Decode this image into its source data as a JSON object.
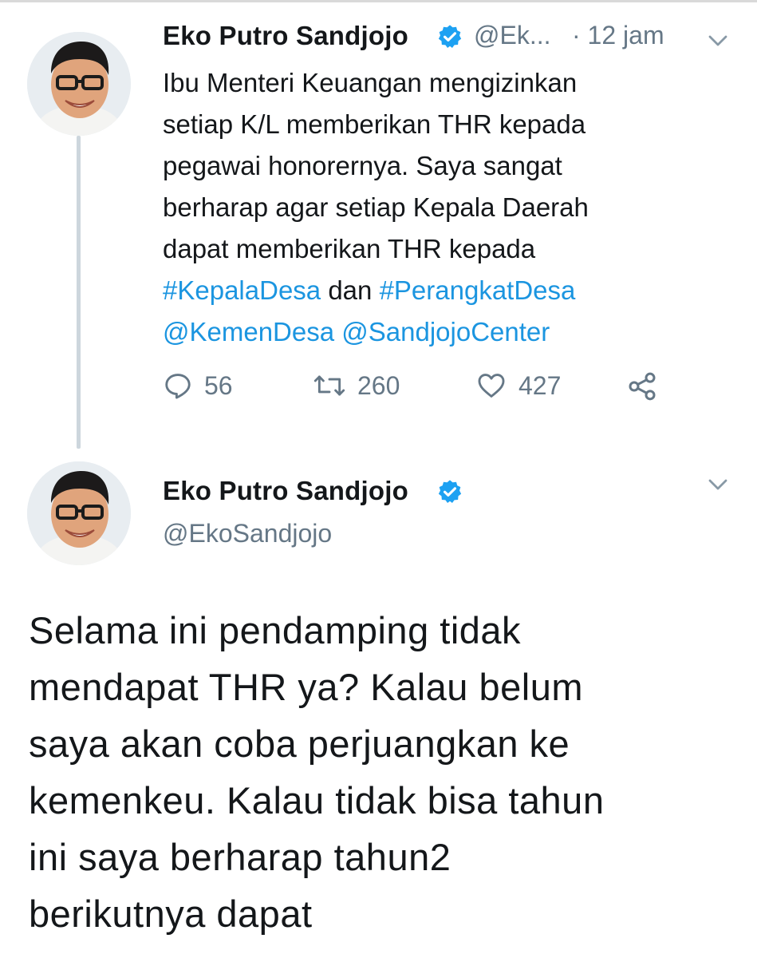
{
  "tweet1": {
    "author_name": "Eko Putro Sandjojo",
    "handle": "@Ek...",
    "time": "· 12 jam",
    "body_lines": [
      "Ibu Menteri Keuangan mengizinkan",
      "setiap K/L memberikan THR kepada",
      "pegawai honorernya. Saya sangat",
      "berharap agar setiap Kepala Daerah",
      "dapat memberikan THR kepada"
    ],
    "hashtag1": "#KepalaDesa",
    "conjunction": " dan ",
    "hashtag2": "#PerangkatDesa",
    "mention1": "@KemenDesa",
    "mention2": "@SandjojoCenter",
    "reply_count": "56",
    "retweet_count": "260",
    "like_count": "427"
  },
  "tweet2": {
    "author_name": "Eko Putro Sandjojo",
    "handle": "@EkoSandjojo",
    "body_lines": [
      "Selama ini pendamping tidak",
      "mendapat THR ya? Kalau belum",
      "saya akan coba perjuangkan ke",
      "kemenkeu. Kalau tidak bisa tahun",
      "ini saya berharap tahun2",
      "berikutnya dapat"
    ]
  },
  "colors": {
    "link": "#1b95e0",
    "secondary_text": "#657786",
    "verified": "#1da1f2",
    "thread_line": "#cdd6dd"
  },
  "icons": {
    "reply": "reply-icon",
    "retweet": "retweet-icon",
    "like": "heart-icon",
    "share": "share-icon",
    "verified": "verified-badge-icon",
    "menu": "chevron-down-icon"
  }
}
